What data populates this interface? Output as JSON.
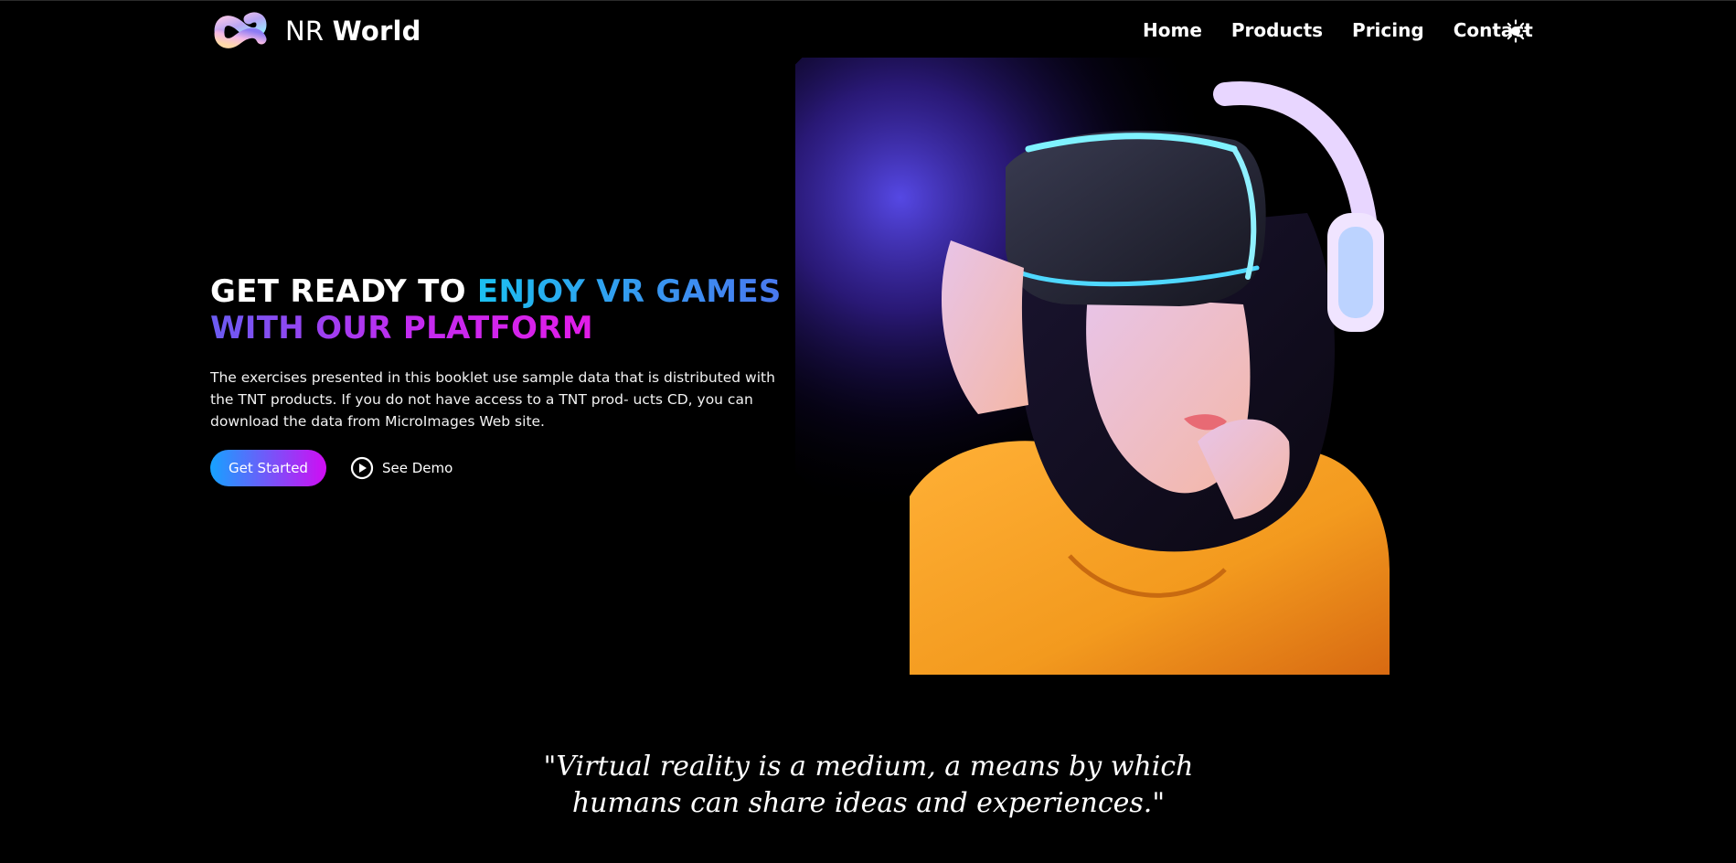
{
  "brand": {
    "name_light": "NR",
    "name_bold": "World",
    "logo": "infinity-logo-icon"
  },
  "nav": {
    "links": [
      "Home",
      "Products",
      "Pricing",
      "Contact"
    ],
    "theme_toggle_icon": "sun-icon"
  },
  "hero": {
    "title_plain": "GET READY TO ",
    "title_accent1": "ENJOY VR GAMES",
    "title_accent2": "WITH OUR PLATFORM",
    "description": "The exercises presented in this booklet use sample data that is distributed with the TNT products. If you do not have access to a TNT prod- ucts CD, you can download the data from MicroImages Web site.",
    "primary_button": "Get Started",
    "secondary_button": "See Demo",
    "secondary_icon": "play-circle-icon",
    "image_subject": "vr-headset-photo"
  },
  "quote": {
    "line1": "\"Virtual reality is a medium, a means by which",
    "line2": "humans can share ideas and experiences.\""
  },
  "colors": {
    "background": "#000000",
    "accent_cyan": "#1cc0f0",
    "accent_purple": "#c02cf0",
    "button_gradient_start": "#16a2ff",
    "button_gradient_end": "#d10cf3"
  }
}
